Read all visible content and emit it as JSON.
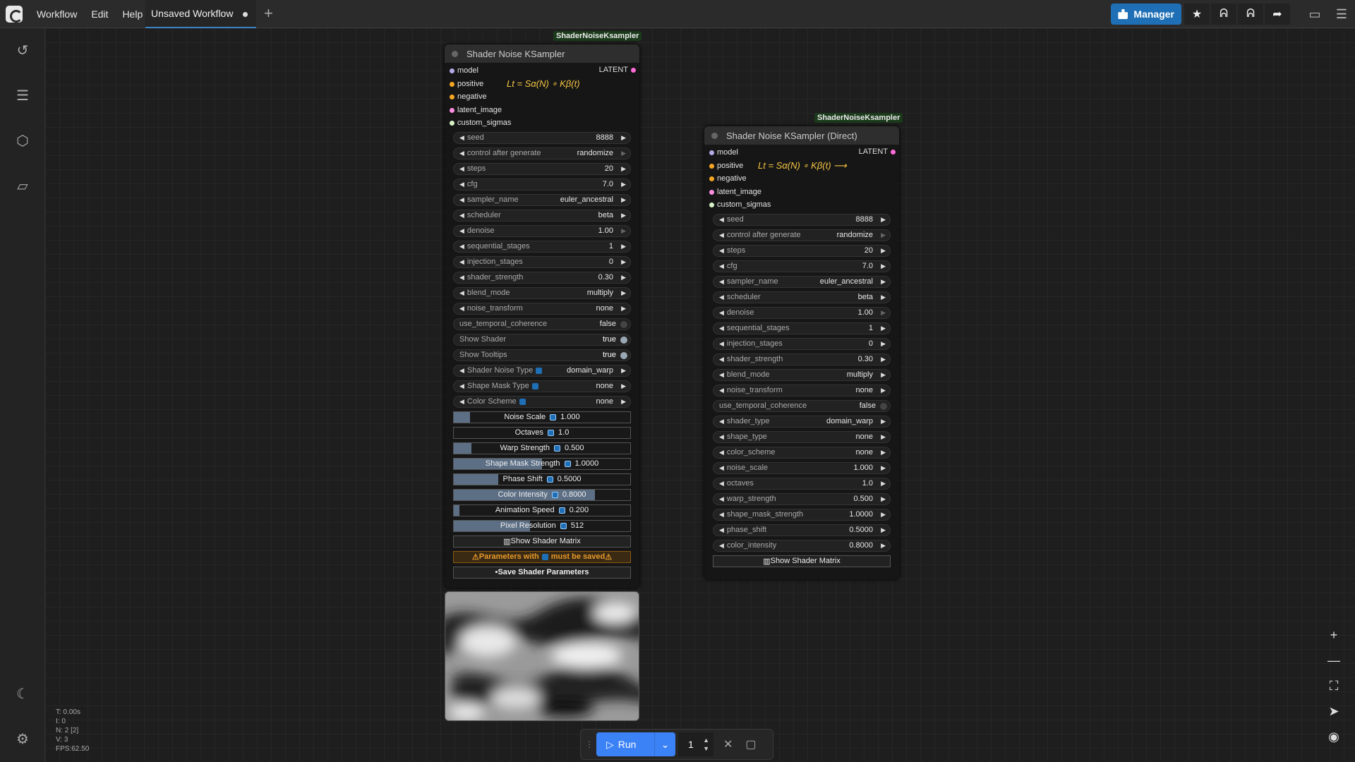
{
  "topbar": {
    "menu": [
      "Workflow",
      "Edit",
      "Help"
    ],
    "tab_title": "Unsaved Workflow",
    "manager_label": "Manager"
  },
  "node1": {
    "badge": "ShaderNoiseKsampler",
    "title": "Shader Noise KSampler",
    "output": "LATENT",
    "formula": "Lt = Sα(N) ∘ Kβ(t)",
    "inputs": [
      {
        "label": "model",
        "color": "#b6a9e8"
      },
      {
        "label": "positive",
        "color": "#f5a623"
      },
      {
        "label": "negative",
        "color": "#f5a623"
      },
      {
        "label": "latent_image",
        "color": "#ff8ee5"
      },
      {
        "label": "custom_sigmas",
        "color": "#d7f2c6"
      }
    ],
    "widgets": [
      {
        "label": "seed",
        "value": "8888"
      },
      {
        "label": "control after generate",
        "value": "randomize"
      },
      {
        "label": "steps",
        "value": "20"
      },
      {
        "label": "cfg",
        "value": "7.0"
      },
      {
        "label": "sampler_name",
        "value": "euler_ancestral"
      },
      {
        "label": "scheduler",
        "value": "beta"
      },
      {
        "label": "denoise",
        "value": "1.00"
      },
      {
        "label": "sequential_stages",
        "value": "1"
      },
      {
        "label": "injection_stages",
        "value": "0"
      },
      {
        "label": "shader_strength",
        "value": "0.30"
      },
      {
        "label": "blend_mode",
        "value": "multiply"
      },
      {
        "label": "noise_transform",
        "value": "none"
      }
    ],
    "bools": [
      {
        "label": "use_temporal_coherence",
        "value": "false"
      },
      {
        "label": "Show Shader",
        "value": "true"
      },
      {
        "label": "Show Tooltips",
        "value": "true"
      }
    ],
    "combos": [
      {
        "label": "Shader Noise Type",
        "value": "domain_warp"
      },
      {
        "label": "Shape Mask Type",
        "value": "none"
      },
      {
        "label": "Color Scheme",
        "value": "none"
      }
    ],
    "sliders": [
      {
        "label": "Noise Scale",
        "value": "1.000",
        "fill": 0.09
      },
      {
        "label": "Octaves",
        "value": "1.0",
        "fill": 0.0
      },
      {
        "label": "Warp Strength",
        "value": "0.500",
        "fill": 0.1
      },
      {
        "label": "Shape Mask Strength",
        "value": "1.0000",
        "fill": 0.5
      },
      {
        "label": "Phase Shift",
        "value": "0.5000",
        "fill": 0.25
      },
      {
        "label": "Color Intensity",
        "value": "0.8000",
        "fill": 0.8
      },
      {
        "label": "Animation Speed",
        "value": "0.200",
        "fill": 0.03
      },
      {
        "label": "Pixel Resolution",
        "value": "512",
        "fill": 0.43
      }
    ],
    "show_matrix": "Show Shader Matrix",
    "warning_a": "Parameters with",
    "warning_b": "must be saved",
    "save_label": "Save Shader Parameters"
  },
  "node2": {
    "badge": "ShaderNoiseKsampler",
    "title": "Shader Noise KSampler (Direct)",
    "output": "LATENT",
    "formula": "Lt = Sα(N) ∘ Kβ(t) ⟶",
    "inputs": [
      {
        "label": "model",
        "color": "#b6a9e8"
      },
      {
        "label": "positive",
        "color": "#f5a623"
      },
      {
        "label": "negative",
        "color": "#f5a623"
      },
      {
        "label": "latent_image",
        "color": "#ff8ee5"
      },
      {
        "label": "custom_sigmas",
        "color": "#d7f2c6"
      }
    ],
    "widgets": [
      {
        "label": "seed",
        "value": "8888"
      },
      {
        "label": "control after generate",
        "value": "randomize"
      },
      {
        "label": "steps",
        "value": "20"
      },
      {
        "label": "cfg",
        "value": "7.0"
      },
      {
        "label": "sampler_name",
        "value": "euler_ancestral"
      },
      {
        "label": "scheduler",
        "value": "beta"
      },
      {
        "label": "denoise",
        "value": "1.00"
      },
      {
        "label": "sequential_stages",
        "value": "1"
      },
      {
        "label": "injection_stages",
        "value": "0"
      },
      {
        "label": "shader_strength",
        "value": "0.30"
      },
      {
        "label": "blend_mode",
        "value": "multiply"
      },
      {
        "label": "noise_transform",
        "value": "none"
      }
    ],
    "bools": [
      {
        "label": "use_temporal_coherence",
        "value": "false"
      }
    ],
    "widgets2": [
      {
        "label": "shader_type",
        "value": "domain_warp"
      },
      {
        "label": "shape_type",
        "value": "none"
      },
      {
        "label": "color_scheme",
        "value": "none"
      },
      {
        "label": "noise_scale",
        "value": "1.000"
      },
      {
        "label": "octaves",
        "value": "1.0"
      },
      {
        "label": "warp_strength",
        "value": "0.500"
      },
      {
        "label": "shape_mask_strength",
        "value": "1.0000"
      },
      {
        "label": "phase_shift",
        "value": "0.5000"
      },
      {
        "label": "color_intensity",
        "value": "0.8000"
      }
    ],
    "show_matrix": "Show Shader Matrix"
  },
  "runbar": {
    "run_label": "Run",
    "count": "1"
  },
  "stats": [
    "T: 0.00s",
    "I: 0",
    "N: 2 [2]",
    "V: 3",
    "FPS:62.50"
  ]
}
